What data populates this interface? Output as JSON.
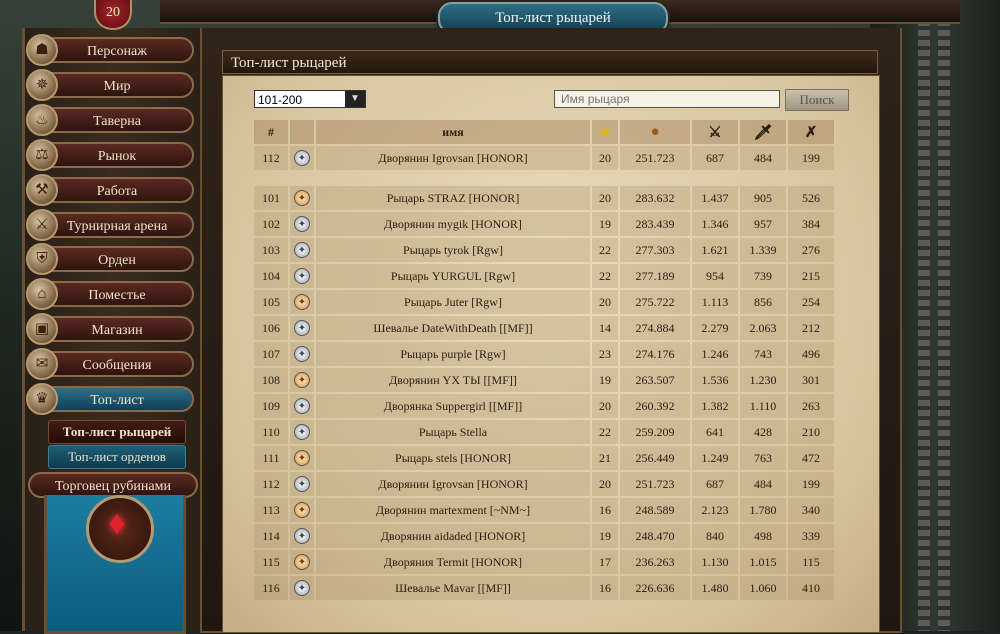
{
  "header": {
    "title": "Топ-лист рыцарей",
    "level": "20"
  },
  "sidebar": {
    "items": [
      {
        "label": "Персонаж",
        "icon": "character-icon"
      },
      {
        "label": "Мир",
        "icon": "compass-icon"
      },
      {
        "label": "Таверна",
        "icon": "tavern-icon"
      },
      {
        "label": "Рынок",
        "icon": "market-icon"
      },
      {
        "label": "Работа",
        "icon": "work-icon"
      },
      {
        "label": "Турнирная арена",
        "icon": "arena-icon"
      },
      {
        "label": "Орден",
        "icon": "order-icon"
      },
      {
        "label": "Поместье",
        "icon": "estate-icon"
      },
      {
        "label": "Магазин",
        "icon": "shop-icon"
      },
      {
        "label": "Сообщения",
        "icon": "messages-icon"
      },
      {
        "label": "Топ-лист",
        "icon": "trophy-icon"
      }
    ],
    "sub_items": [
      "Топ-лист рыцарей",
      "Топ-лист орденов"
    ],
    "ruby_merchant": "Торговец рубинами"
  },
  "panel": {
    "title": "Топ-лист рыцарей"
  },
  "filter": {
    "range": "101-200",
    "search_placeholder": "Имя рыцаря",
    "search_button": "Поиск"
  },
  "table": {
    "columns": [
      "#",
      "",
      "имя",
      "level-star-icon",
      "score-icon",
      "crossed-swords-icon",
      "sword-icon",
      "dagger-icon"
    ],
    "name_header": "имя",
    "own_row": {
      "rank": "112",
      "emblem": "knight",
      "name": "Дворянин Igrovsan [HONOR]",
      "level": "20",
      "score": "251.723",
      "s1": "687",
      "s2": "484",
      "s3": "199"
    },
    "rows": [
      {
        "rank": "101",
        "emblem": "noble",
        "name": "Рыцарь STRAZ [HONOR]",
        "level": "20",
        "score": "283.632",
        "s1": "1.437",
        "s2": "905",
        "s3": "526"
      },
      {
        "rank": "102",
        "emblem": "knight",
        "name": "Дворянин mygik [HONOR]",
        "level": "19",
        "score": "283.439",
        "s1": "1.346",
        "s2": "957",
        "s3": "384"
      },
      {
        "rank": "103",
        "emblem": "knight",
        "name": "Рыцарь tyrok [Rgw]",
        "level": "22",
        "score": "277.303",
        "s1": "1.621",
        "s2": "1.339",
        "s3": "276"
      },
      {
        "rank": "104",
        "emblem": "knight",
        "name": "Рыцарь YURGUL [Rgw]",
        "level": "22",
        "score": "277.189",
        "s1": "954",
        "s2": "739",
        "s3": "215"
      },
      {
        "rank": "105",
        "emblem": "noble",
        "name": "Рыцарь Juter [Rgw]",
        "level": "20",
        "score": "275.722",
        "s1": "1.113",
        "s2": "856",
        "s3": "254"
      },
      {
        "rank": "106",
        "emblem": "knight",
        "name": "Шевалье DateWithDeath [[MF]]",
        "level": "14",
        "score": "274.884",
        "s1": "2.279",
        "s2": "2.063",
        "s3": "212"
      },
      {
        "rank": "107",
        "emblem": "knight",
        "name": "Рыцарь purple [Rgw]",
        "level": "23",
        "score": "274.176",
        "s1": "1.246",
        "s2": "743",
        "s3": "496"
      },
      {
        "rank": "108",
        "emblem": "noble",
        "name": "Дворянин YX TЫ [[MF]]",
        "level": "19",
        "score": "263.507",
        "s1": "1.536",
        "s2": "1.230",
        "s3": "301"
      },
      {
        "rank": "109",
        "emblem": "knight",
        "name": "Дворянка Suppergirl [[MF]]",
        "level": "20",
        "score": "260.392",
        "s1": "1.382",
        "s2": "1.110",
        "s3": "263"
      },
      {
        "rank": "110",
        "emblem": "knight",
        "name": "Рыцарь Stella",
        "level": "22",
        "score": "259.209",
        "s1": "641",
        "s2": "428",
        "s3": "210"
      },
      {
        "rank": "111",
        "emblem": "noble",
        "name": "Рыцарь stels [HONOR]",
        "level": "21",
        "score": "256.449",
        "s1": "1.249",
        "s2": "763",
        "s3": "472"
      },
      {
        "rank": "112",
        "emblem": "knight",
        "name": "Дворянин Igrovsan [HONOR]",
        "level": "20",
        "score": "251.723",
        "s1": "687",
        "s2": "484",
        "s3": "199"
      },
      {
        "rank": "113",
        "emblem": "noble",
        "name": "Дворянин martexment [~NM~]",
        "level": "16",
        "score": "248.589",
        "s1": "2.123",
        "s2": "1.780",
        "s3": "340"
      },
      {
        "rank": "114",
        "emblem": "knight",
        "name": "Дворянин aidaded [HONOR]",
        "level": "19",
        "score": "248.470",
        "s1": "840",
        "s2": "498",
        "s3": "339"
      },
      {
        "rank": "115",
        "emblem": "noble",
        "name": "Дворяния Termit [HONOR]",
        "level": "17",
        "score": "236.263",
        "s1": "1.130",
        "s2": "1.015",
        "s3": "115"
      },
      {
        "rank": "116",
        "emblem": "knight",
        "name": "Шевалье Mavar [[MF]]",
        "level": "16",
        "score": "226.636",
        "s1": "1.480",
        "s2": "1.060",
        "s3": "410"
      }
    ]
  }
}
